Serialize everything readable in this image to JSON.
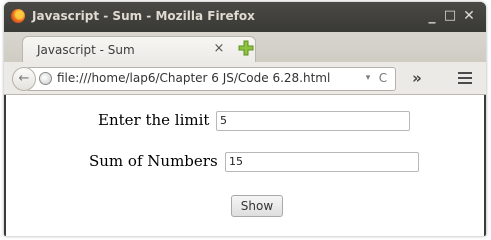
{
  "window": {
    "title": "Javascript - Sum - Mozilla Firefox",
    "minimize_glyph": "_",
    "maximize_glyph": "□",
    "close_glyph": "✕"
  },
  "tabs": [
    {
      "label": "Javascript - Sum",
      "close_glyph": "×"
    }
  ],
  "navbar": {
    "back_glyph": "←",
    "url": "file:///home/lap6/Chapter 6 JS/Code 6.28.html",
    "dropdown_glyph": "▾",
    "reload_glyph": "C",
    "overflow_glyph": "»"
  },
  "page": {
    "limit_label": "Enter the limit",
    "limit_value": "5",
    "sum_label": "Sum of Numbers",
    "sum_value": "15",
    "show_label": "Show"
  },
  "colors": {
    "titlebar": "#3b3b37",
    "tabstrip": "#d9d6cf",
    "newtab_plus": "#8ec43d"
  }
}
